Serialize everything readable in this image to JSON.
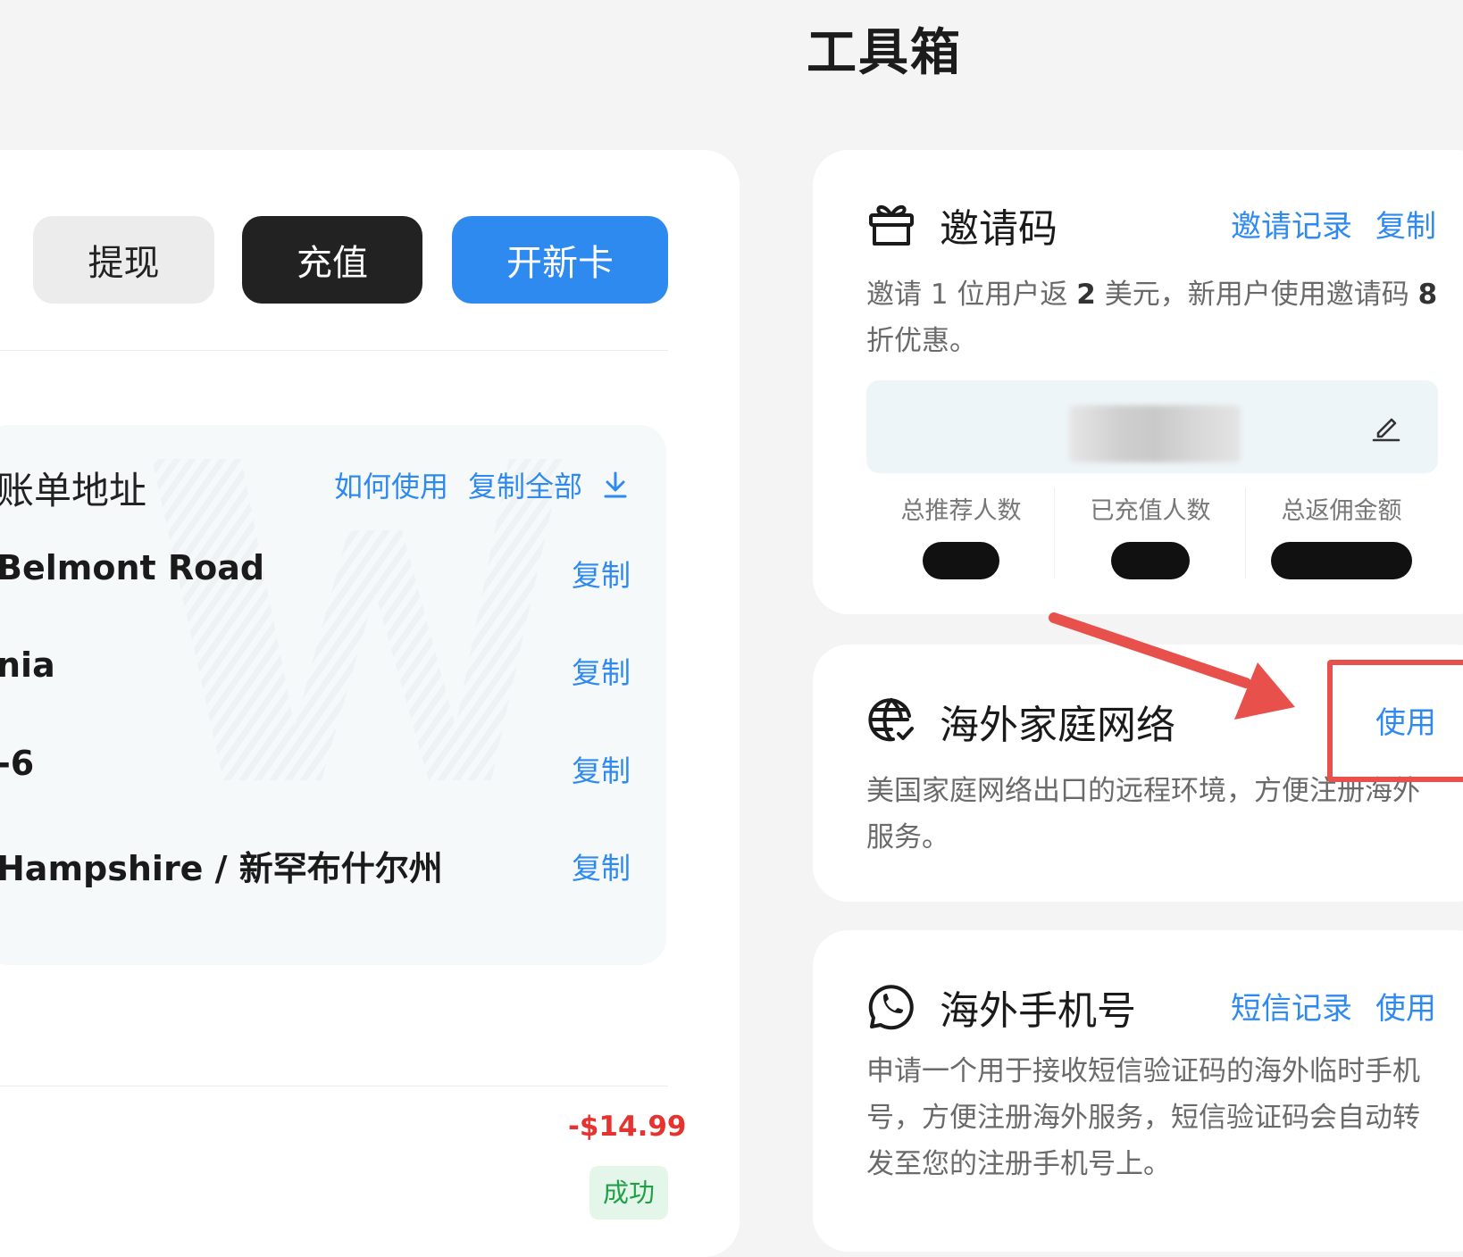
{
  "page": {
    "title": "工具箱"
  },
  "actions": {
    "withdraw": "提现",
    "recharge": "充值",
    "new_card": "开新卡"
  },
  "billing": {
    "title": "账单地址",
    "how_to_use": "如何使用",
    "copy_all": "复制全部",
    "download_icon": "download-icon",
    "rows": [
      {
        "value": "Belmont Road",
        "copy": "复制"
      },
      {
        "value": "nia",
        "copy": "复制"
      },
      {
        "value": "-6",
        "copy": "复制"
      },
      {
        "value": " Hampshire / 新罕布什尔州",
        "copy": "复制"
      }
    ]
  },
  "transaction": {
    "amount": "-$14.99",
    "status": "成功"
  },
  "invite": {
    "icon": "gift-icon",
    "title": "邀请码",
    "records_link": "邀请记录",
    "copy_link": "复制",
    "desc_part1": "邀请 1 位用户返 ",
    "desc_bold1": "2",
    "desc_part2": " 美元，新用户使用邀请码 ",
    "desc_bold2": "8",
    "desc_part3": " 折优惠。",
    "stats": [
      {
        "label": "总推荐人数"
      },
      {
        "label": "已充值人数"
      },
      {
        "label": "总返佣金额"
      }
    ]
  },
  "home_network": {
    "icon": "globe-icon",
    "title": "海外家庭网络",
    "use_link": "使用",
    "desc": "美国家庭网络出口的远程环境，方便注册海外服务。"
  },
  "overseas_phone": {
    "icon": "whatsapp-icon",
    "title": "海外手机号",
    "sms_link": "短信记录",
    "use_link": "使用",
    "desc": "申请一个用于接收短信验证码的海外临时手机号，方便注册海外服务，短信验证码会自动转发至您的注册手机号上。"
  },
  "colors": {
    "accent": "#2f8af0",
    "dark": "#222222",
    "negative": "#e5332f",
    "success": "#21a049",
    "annotation": "#e8504c"
  }
}
